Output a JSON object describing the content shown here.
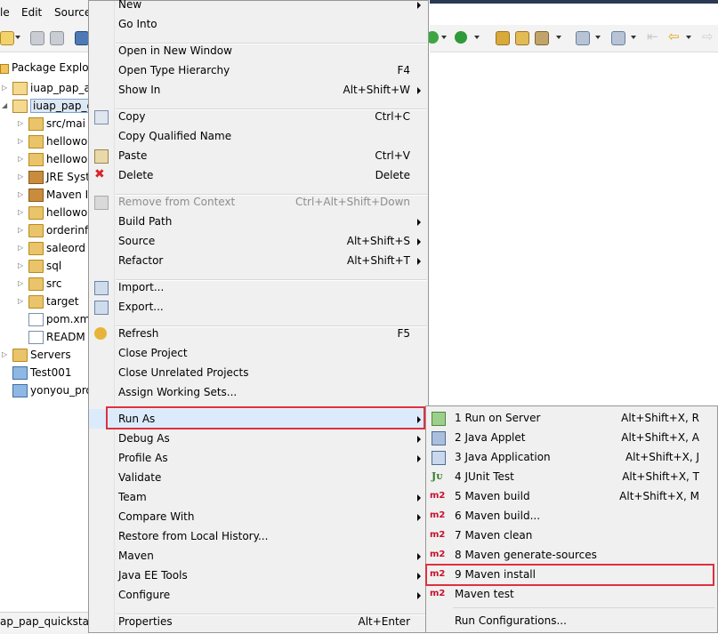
{
  "menubar": {
    "items": [
      "le",
      "Edit",
      "Source"
    ]
  },
  "package_explorer": {
    "tab_label": "Package Explo",
    "tree": [
      {
        "label": "iuap_pap_a",
        "icon": "maven-project-icon",
        "arrow": "▷",
        "indent": 0
      },
      {
        "label": "iuap_pap_q",
        "icon": "maven-project-icon",
        "arrow": "◢",
        "indent": 0,
        "selected": true
      },
      {
        "label": "src/mai",
        "icon": "source-folder-icon",
        "arrow": "▷",
        "indent": 1
      },
      {
        "label": "hellowo",
        "icon": "package-folder-icon",
        "arrow": "▷",
        "indent": 1
      },
      {
        "label": "hellowo",
        "icon": "package-folder-icon",
        "arrow": "▷",
        "indent": 1
      },
      {
        "label": "JRE Syst",
        "icon": "library-icon",
        "arrow": "▷",
        "indent": 1
      },
      {
        "label": "Maven I",
        "icon": "library-icon",
        "arrow": "▷",
        "indent": 1
      },
      {
        "label": "hellowo",
        "icon": "folder-icon",
        "arrow": "▷",
        "indent": 1
      },
      {
        "label": "orderinf",
        "icon": "folder-icon",
        "arrow": "▷",
        "indent": 1
      },
      {
        "label": "saleord",
        "icon": "folder-icon",
        "arrow": "▷",
        "indent": 1
      },
      {
        "label": "sql",
        "icon": "folder-icon",
        "arrow": "▷",
        "indent": 1
      },
      {
        "label": "src",
        "icon": "folder-icon",
        "arrow": "▷",
        "indent": 1
      },
      {
        "label": "target",
        "icon": "folder-icon",
        "arrow": "▷",
        "indent": 1
      },
      {
        "label": "pom.xm",
        "icon": "pom-file-icon",
        "arrow": "",
        "indent": 1
      },
      {
        "label": "READM",
        "icon": "file-icon",
        "arrow": "",
        "indent": 1
      },
      {
        "label": "Servers",
        "icon": "folder-icon",
        "arrow": "▷",
        "indent": 0
      },
      {
        "label": "Test001",
        "icon": "project-folder-icon",
        "arrow": "",
        "indent": 0
      },
      {
        "label": "yonyou_pro",
        "icon": "project-folder-icon",
        "arrow": "",
        "indent": 0
      }
    ]
  },
  "status_fragment": "ap_pap_quickstar",
  "context_menu": {
    "items": [
      {
        "label": "New",
        "shortcut": "",
        "submenu": true
      },
      {
        "label": "Go Into",
        "shortcut": ""
      },
      {
        "sep": true
      },
      {
        "label": "Open in New Window",
        "shortcut": ""
      },
      {
        "label": "Open Type Hierarchy",
        "shortcut": "F4"
      },
      {
        "label": "Show In",
        "shortcut": "Alt+Shift+W",
        "submenu": true
      },
      {
        "sep": true
      },
      {
        "label": "Copy",
        "shortcut": "Ctrl+C",
        "icon": "copy-icon"
      },
      {
        "label": "Copy Qualified Name",
        "shortcut": ""
      },
      {
        "label": "Paste",
        "shortcut": "Ctrl+V",
        "icon": "paste-icon"
      },
      {
        "label": "Delete",
        "shortcut": "Delete",
        "icon": "delete-icon"
      },
      {
        "sep": true
      },
      {
        "label": "Remove from Context",
        "shortcut": "Ctrl+Alt+Shift+Down",
        "disabled": true,
        "icon": "remove-context-icon"
      },
      {
        "label": "Build Path",
        "shortcut": "",
        "submenu": true
      },
      {
        "label": "Source",
        "shortcut": "Alt+Shift+S",
        "submenu": true
      },
      {
        "label": "Refactor",
        "shortcut": "Alt+Shift+T",
        "submenu": true
      },
      {
        "sep": true
      },
      {
        "label": "Import...",
        "shortcut": "",
        "icon": "import-icon"
      },
      {
        "label": "Export...",
        "shortcut": "",
        "icon": "export-icon"
      },
      {
        "sep": true
      },
      {
        "label": "Refresh",
        "shortcut": "F5",
        "icon": "refresh-icon"
      },
      {
        "label": "Close Project",
        "shortcut": ""
      },
      {
        "label": "Close Unrelated Projects",
        "shortcut": ""
      },
      {
        "label": "Assign Working Sets...",
        "shortcut": ""
      },
      {
        "sep": true
      },
      {
        "label": "Run As",
        "shortcut": "",
        "submenu": true,
        "highlight": true
      },
      {
        "label": "Debug As",
        "shortcut": "",
        "submenu": true
      },
      {
        "label": "Profile As",
        "shortcut": "",
        "submenu": true
      },
      {
        "label": "Validate",
        "shortcut": ""
      },
      {
        "label": "Team",
        "shortcut": "",
        "submenu": true
      },
      {
        "label": "Compare With",
        "shortcut": "",
        "submenu": true
      },
      {
        "label": "Restore from Local History...",
        "shortcut": ""
      },
      {
        "label": "Maven",
        "shortcut": "",
        "submenu": true
      },
      {
        "label": "Java EE Tools",
        "shortcut": "",
        "submenu": true
      },
      {
        "label": "Configure",
        "shortcut": "",
        "submenu": true
      },
      {
        "sep": true
      },
      {
        "label": "Properties",
        "shortcut": "Alt+Enter"
      }
    ]
  },
  "run_as_submenu": {
    "items": [
      {
        "label": "1 Run on Server",
        "shortcut": "Alt+Shift+X, R",
        "icon": "run-server-icon"
      },
      {
        "label": "2 Java Applet",
        "shortcut": "Alt+Shift+X, A",
        "icon": "java-applet-icon"
      },
      {
        "label": "3 Java Application",
        "shortcut": "Alt+Shift+X, J",
        "icon": "java-application-icon"
      },
      {
        "label": "4 JUnit Test",
        "shortcut": "Alt+Shift+X, T",
        "icon": "junit-icon"
      },
      {
        "label": "5 Maven build",
        "shortcut": "Alt+Shift+X, M",
        "m2": "m2"
      },
      {
        "label": "6 Maven build...",
        "shortcut": "",
        "m2": "m2"
      },
      {
        "label": "7 Maven clean",
        "shortcut": "",
        "m2": "m2"
      },
      {
        "label": "8 Maven generate-sources",
        "shortcut": "",
        "m2": "m2"
      },
      {
        "label": "9 Maven install",
        "shortcut": "",
        "m2": "m2",
        "highlight": true
      },
      {
        "label": "Maven test",
        "shortcut": "",
        "m2": "m2"
      },
      {
        "sep": true
      },
      {
        "label": "Run Configurations...",
        "shortcut": ""
      }
    ]
  },
  "colors": {
    "highlight_box": "#e0303e",
    "menu_bg": "#f0f0f0",
    "m2_red": "#c8102e"
  }
}
